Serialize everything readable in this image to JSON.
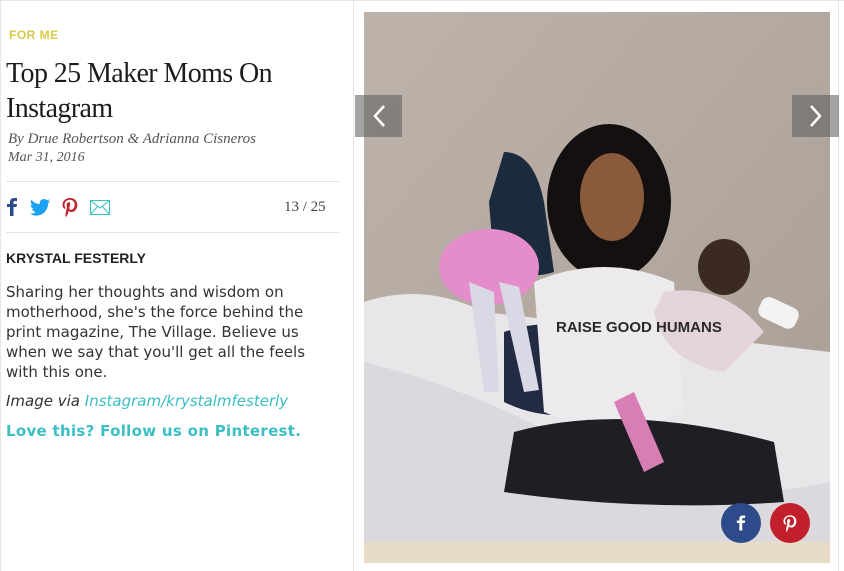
{
  "article": {
    "category": "FOR ME",
    "title": "Top 25 Maker Moms On Instagram",
    "byline": "By  Drue Robertson & Adrianna Cisneros",
    "date": "Mar 31, 2016"
  },
  "gallery": {
    "counter": "13 / 25",
    "person_name": "KRYSTAL FESTERLY",
    "description": "Sharing her thoughts and wisdom on motherhood, she's the force behind the print magazine, The Village. Believe us when we say that you'll get all the feels with this one.",
    "credit_label": "Image via",
    "credit_link": "Instagram/krystalmfesterly",
    "cta": "Love this? Follow us on Pinterest.",
    "photo_shirt_text": "RAISE GOOD HUMANS"
  },
  "share_icons": [
    "facebook-icon",
    "twitter-icon",
    "pinterest-icon",
    "email-icon"
  ],
  "colors": {
    "category": "#d8c94a",
    "link": "#3bbfc4",
    "facebook": "#2d4a8a",
    "twitter": "#1da1f2",
    "pinterest": "#c11f2b"
  }
}
